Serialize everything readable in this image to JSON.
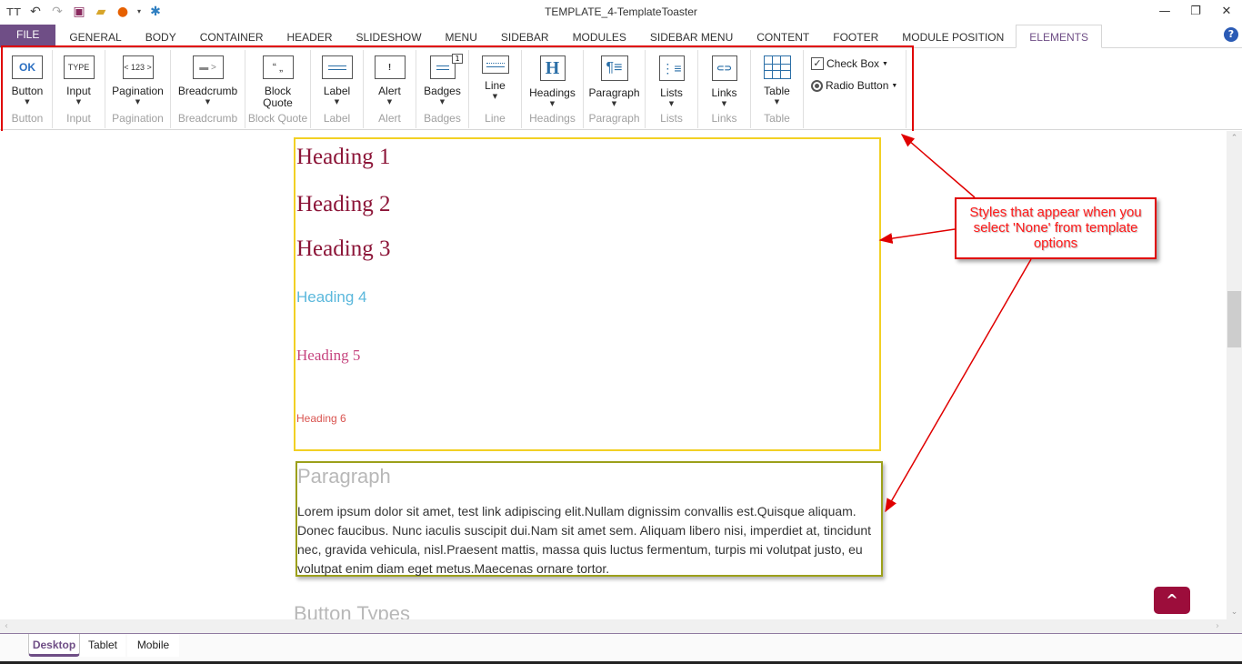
{
  "window": {
    "title": "TEMPLATE_4-TemplateToaster",
    "controls": [
      "minimize",
      "restore",
      "close"
    ]
  },
  "quick_access": [
    "text-size-icon",
    "undo-icon",
    "redo-icon",
    "save-icon",
    "open-folder-icon",
    "firefox-icon",
    "joomla-icon"
  ],
  "tabs": {
    "file": "FILE",
    "items": [
      "GENERAL",
      "BODY",
      "CONTAINER",
      "HEADER",
      "SLIDESHOW",
      "MENU",
      "SIDEBAR",
      "MODULES",
      "SIDEBAR MENU",
      "CONTENT",
      "FOOTER",
      "MODULE POSITION",
      "ELEMENTS"
    ],
    "active": "ELEMENTS",
    "help": "?"
  },
  "ribbon": {
    "groups": [
      {
        "label": "Button",
        "group": "Button",
        "icon_text": "OK"
      },
      {
        "label": "Input",
        "group": "Input",
        "icon_text": "TYPE"
      },
      {
        "label": "Pagination",
        "group": "Pagination",
        "icon_text": "< 123 >"
      },
      {
        "label": "Breadcrumb",
        "group": "Breadcrumb",
        "icon_text": "▬ >"
      },
      {
        "label": "Block Quote",
        "group": "Block Quote",
        "icon_text": "“ „"
      },
      {
        "label": "Label",
        "group": "Label",
        "icon_text": ""
      },
      {
        "label": "Alert",
        "group": "Alert",
        "icon_text": "!"
      },
      {
        "label": "Badges",
        "group": "Badges",
        "icon_text": "",
        "badge": "1"
      },
      {
        "label": "Line",
        "group": "Line",
        "icon_text": ""
      },
      {
        "label": "Headings",
        "group": "Headings",
        "icon_text": "H"
      },
      {
        "label": "Paragraph",
        "group": "Paragraph",
        "icon_text": "¶≡"
      },
      {
        "label": "Lists",
        "group": "Lists",
        "icon_text": "⋮≡"
      },
      {
        "label": "Links",
        "group": "Links",
        "icon_text": "⊂⊃"
      },
      {
        "label": "Table",
        "group": "Table",
        "icon_text": ""
      }
    ],
    "check_box": "Check Box",
    "radio_button": "Radio Button"
  },
  "canvas": {
    "headings": [
      "Heading 1",
      "Heading 2",
      "Heading 3",
      "Heading 4",
      "Heading 5",
      "Heading 6"
    ],
    "paragraph_title": "Paragraph",
    "paragraph_text": "Lorem ipsum dolor sit amet, test link adipiscing elit.Nullam dignissim convallis est.Quisque aliquam. Donec faucibus. Nunc iaculis suscipit dui.Nam sit amet sem. Aliquam libero nisi, imperdiet at, tincidunt nec, gravida vehicula, nisl.Praesent mattis, massa quis luctus fermentum, turpis mi volutpat justo, eu volutpat enim diam eget metus.Maecenas ornare tortor.",
    "next_section": "Button Types",
    "scroll_top": "^"
  },
  "annotation": {
    "text": "Styles that appear when you select 'None' from template options",
    "color": "#e00000"
  },
  "device_tabs": {
    "items": [
      "Desktop",
      "Tablet",
      "Mobile"
    ],
    "active": "Desktop"
  },
  "colors": {
    "accent": "#6f4e86",
    "heading": "#8c1538",
    "heading4": "#5bb8dc",
    "heading5": "#c6457f",
    "heading6": "#d9534f",
    "heading_box_border": "#f2d024",
    "paragraph_box_border": "#9ca01a",
    "scroll_top_button": "#9c0d3b"
  }
}
